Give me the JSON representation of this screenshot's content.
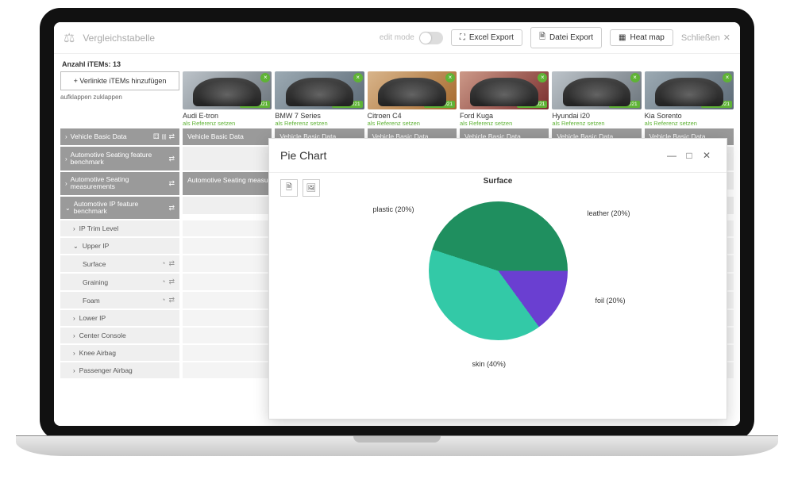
{
  "header": {
    "title": "Vergleichstabelle",
    "edit_mode_label": "edit mode",
    "excel_btn": "Excel Export",
    "file_btn": "Datei Export",
    "heatmap_btn": "Heat map",
    "close_btn": "Schließen"
  },
  "count_label": "Anzahl iTEMs: 13",
  "add_btn": "+  Verlinkte iTEMs hinzufügen",
  "fold_label": "aufklappen zuklappen",
  "cars": [
    {
      "name": "Audi E-tron",
      "date": "03.08.2021",
      "ref": "als Referenz setzen",
      "tone": "car-gray"
    },
    {
      "name": "BMW 7 Series",
      "date": "03.08.2021",
      "ref": "als Referenz setzen",
      "tone": ""
    },
    {
      "name": "Citroen C4",
      "date": "03.08.2021",
      "ref": "als Referenz setzen",
      "tone": "car-orange"
    },
    {
      "name": "Ford Kuga",
      "date": "03.08.2021",
      "ref": "als Referenz setzen",
      "tone": "car-red"
    },
    {
      "name": "Hyundai i20",
      "date": "03.08.2021",
      "ref": "als Referenz setzen",
      "tone": "car-gray"
    },
    {
      "name": "Kia Sorento",
      "date": "03.08.2021",
      "ref": "als Referenz setzen",
      "tone": ""
    }
  ],
  "sections": {
    "vbd": "Vehicle Basic Data",
    "asfb": "Automotive Seating feature benchmark",
    "asm": "Automotive Seating measurements",
    "asm_cell": "Automotive Seating measurements",
    "aip": "Automotive IP feature benchmark"
  },
  "tree": {
    "ip_trim": "IP Trim Level",
    "upper_ip": "Upper IP",
    "surface": "Surface",
    "graining": "Graining",
    "foam": "Foam",
    "lower_ip": "Lower IP",
    "center_console": "Center Console",
    "knee_airbag": "Knee Airbag",
    "passenger_airbag": "Passenger Airbag"
  },
  "modal": {
    "title": "Pie Chart",
    "chart_title": "Surface"
  },
  "chart_data": {
    "type": "pie",
    "title": "Surface",
    "series": [
      {
        "name": "leather",
        "value": 20,
        "label": "leather (20%)",
        "color": "#1f77e6"
      },
      {
        "name": "foil",
        "value": 20,
        "label": "foil (20%)",
        "color": "#6a3fd1"
      },
      {
        "name": "skin",
        "value": 40,
        "label": "skin (40%)",
        "color": "#33c9a7"
      },
      {
        "name": "plastic",
        "value": 20,
        "label": "plastic (20%)",
        "color": "#1f8f5f"
      }
    ]
  }
}
